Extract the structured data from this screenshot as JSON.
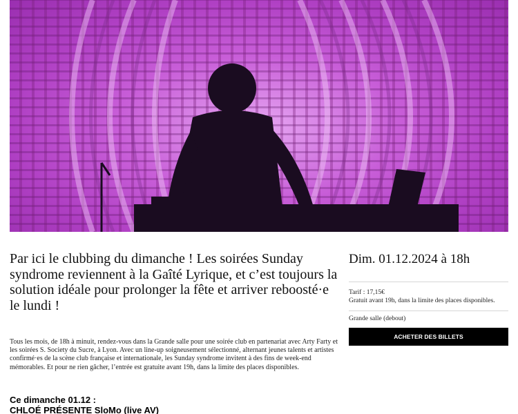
{
  "hero": {
    "image_icon": "stage-performer-photo",
    "colors": {
      "magenta": "#c85ed8",
      "light_pink": "#e6a6f2",
      "silhouette": "#1a0c20"
    }
  },
  "intro": {
    "text": "Par ici le clubbing du dimanche ! Les soirées Sunday syndrome reviennent à la Gaîté Lyrique, et c’est toujours la solution idéale pour prolonger la fête et arriver reboosté·e le lundi !"
  },
  "description": {
    "text": "Tous les mois, de 18h à minuit, rendez-vous dans la Grande salle pour une soirée club en partenariat avec Arty Farty et les soirées S. Society du Sucre, à Lyon. Avec un line-up soigneusement sélectionné, alternant jeunes talents et artistes confirmé·es de la scène club française et internationale, les Sunday syndrome invitent à des fins de week-end mémorables. Et pour ne rien gâcher, l’entrée est gratuite avant 19h, dans la limite des places disponibles."
  },
  "lineup": {
    "heading": "Ce dimanche 01.12 :",
    "artist": "CHLOÉ PRÉSENTE SloMo (live AV)"
  },
  "event": {
    "date": "Dim. 01.12.2024 à 18h",
    "price": "Tarif : 17,15€",
    "free_note": "Gratuit avant 19h, dans la limite des places disponibles.",
    "venue": "Grande salle (debout)",
    "buy_label": "ACHETER DES BILLETS"
  }
}
